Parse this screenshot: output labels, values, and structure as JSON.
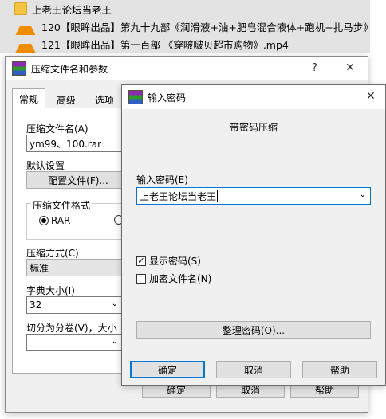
{
  "file_list": [
    {
      "icon": "folder-icon",
      "name": "上老王论坛当老王"
    },
    {
      "icon": "vlc-icon",
      "name": "120【眼眸出品】第九十九部《润滑液+油+肥皂混合液体+跑机+扎马步》.mp4"
    },
    {
      "icon": "vlc-icon",
      "name": "121【眼眸出品】第一百部 《穿啵啵贝超市购物》.mp4"
    }
  ],
  "archive_dialog": {
    "title": "压缩文件名和参数",
    "help_glyph": "?",
    "close_glyph": "✕",
    "tabs": [
      "常规",
      "高级",
      "选项"
    ],
    "archive_name_label": "压缩文件名(A)",
    "archive_name_value": "ym99、100.rar",
    "default_settings_label": "默认设置",
    "profiles_button": "配置文件(F)...",
    "format_group_label": "压缩文件格式",
    "format_rar": "RAR",
    "method_label": "压缩方式(C)",
    "method_value": "标准",
    "dict_label": "字典大小(I)",
    "dict_value": "32",
    "split_label": "切分为分卷(V)，大小",
    "ok": "确定",
    "cancel": "取消",
    "help": "帮助"
  },
  "password_dialog": {
    "title": "输入密码",
    "close_glyph": "✕",
    "header": "带密码压缩",
    "password_label": "输入密码(E)",
    "password_value": "上老王论坛当老王",
    "show_password": "显示密码(S)",
    "show_password_checked": "✓",
    "encrypt_names": "加密文件名(N)",
    "organize_button": "整理密码(O)...",
    "ok": "确定",
    "cancel": "取消",
    "help": "帮助"
  }
}
